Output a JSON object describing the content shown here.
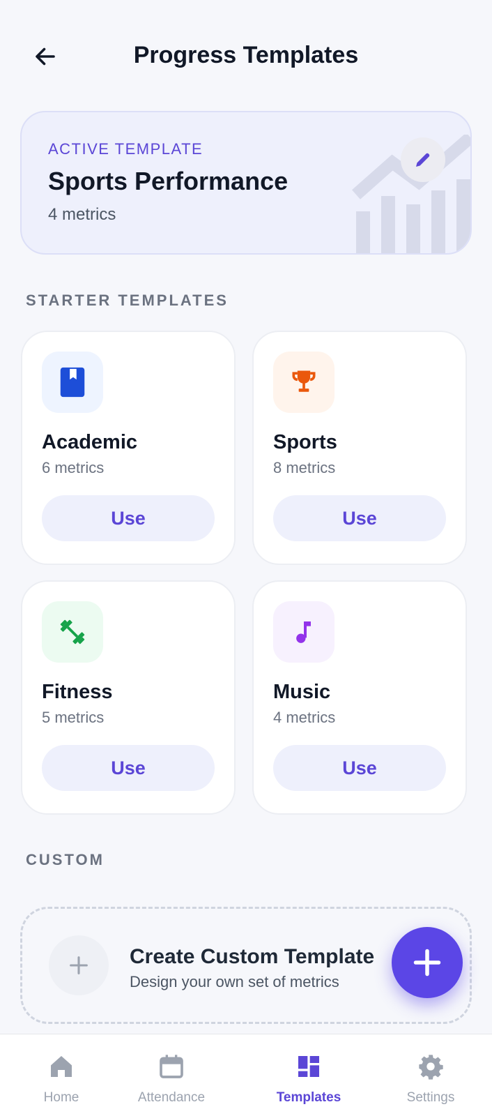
{
  "header": {
    "title": "Progress Templates",
    "back_icon": "arrow-left-icon"
  },
  "active_template": {
    "label": "ACTIVE TEMPLATE",
    "name": "Sports Performance",
    "metrics": "4 metrics",
    "edit_icon": "pencil-icon",
    "decor_icon": "chart-bars-icon"
  },
  "starter": {
    "section_label": "STARTER TEMPLATES",
    "templates": [
      {
        "name": "Academic",
        "metrics": "6 metrics",
        "button": "Use",
        "icon": "book-icon",
        "icon_color": "#1d4ed8",
        "tile_bg": "#eef4ff"
      },
      {
        "name": "Sports",
        "metrics": "8 metrics",
        "button": "Use",
        "icon": "trophy-icon",
        "icon_color": "#ea580c",
        "tile_bg": "#fff4ec"
      },
      {
        "name": "Fitness",
        "metrics": "5 metrics",
        "button": "Use",
        "icon": "dumbbell-icon",
        "icon_color": "#16a34a",
        "tile_bg": "#ecfbf1"
      },
      {
        "name": "Music",
        "metrics": "4 metrics",
        "button": "Use",
        "icon": "music-note-icon",
        "icon_color": "#9333ea",
        "tile_bg": "#f7f1fe"
      }
    ]
  },
  "custom": {
    "section_label": "CUSTOM",
    "title": "Create Custom Template",
    "subtitle": "Design your own set of metrics",
    "icon": "plus-icon"
  },
  "fab": {
    "icon": "plus-icon"
  },
  "nav": {
    "items": [
      {
        "label": "Home",
        "icon": "home-icon",
        "active": false
      },
      {
        "label": "Attendance",
        "icon": "calendar-icon",
        "active": false
      },
      {
        "label": "Templates",
        "icon": "dashboard-icon",
        "active": true
      },
      {
        "label": "Settings",
        "icon": "gear-icon",
        "active": false
      }
    ]
  },
  "colors": {
    "accent": "#5b46d6",
    "fab": "#5b46e6",
    "background": "#f6f7fb",
    "active_card_bg": "#eef0fc",
    "nav_inactive": "#9ca3af"
  }
}
